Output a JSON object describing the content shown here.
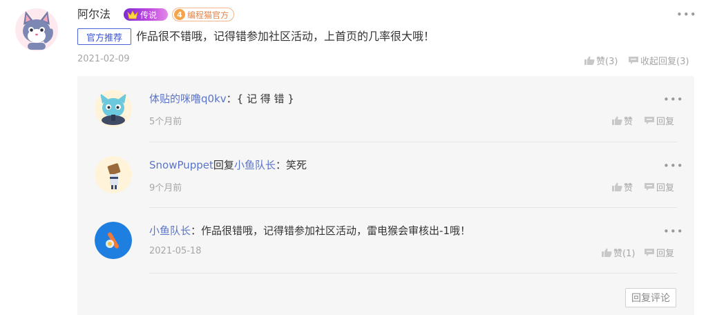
{
  "comment": {
    "author": "阿尔法",
    "badge_legend": "传说",
    "badge_level_num": "4",
    "badge_level_label": "编程猫官方",
    "tag": "官方推荐",
    "text": "作品很不错哦，记得错参加社区活动，上首页的几率很大哦！",
    "date": "2021-02-09",
    "like_label": "赞(3)",
    "collapse_label": "收起回复(3)",
    "more": "•••"
  },
  "replies": [
    {
      "author": "体贴的咪噜q0kv",
      "reply_word": "",
      "target": "",
      "sep": "：",
      "text": "{ 记 得 错 }",
      "date": "5个月前",
      "like_label": "赞",
      "reply_label": "回复",
      "more": "•••"
    },
    {
      "author": "SnowPuppet",
      "reply_word": "回复",
      "target": "小鱼队长",
      "sep": "：",
      "text": "笑死",
      "date": "9个月前",
      "like_label": "赞",
      "reply_label": "回复",
      "more": "•••"
    },
    {
      "author": "小鱼队长",
      "reply_word": "",
      "target": "",
      "sep": "：",
      "text": "作品很错哦，记得错参加社区活动，雷电猴会审核出-1哦！",
      "date": "2021-05-18",
      "like_label": "赞(1)",
      "reply_label": "回复",
      "more": "•••"
    }
  ],
  "reply_comment_button": "回复评论",
  "colors": {
    "link": "#5b74c7",
    "official_tag": "#3b56cf",
    "legend_badge": "#9c3ddd",
    "level_badge": "#e4854a"
  }
}
